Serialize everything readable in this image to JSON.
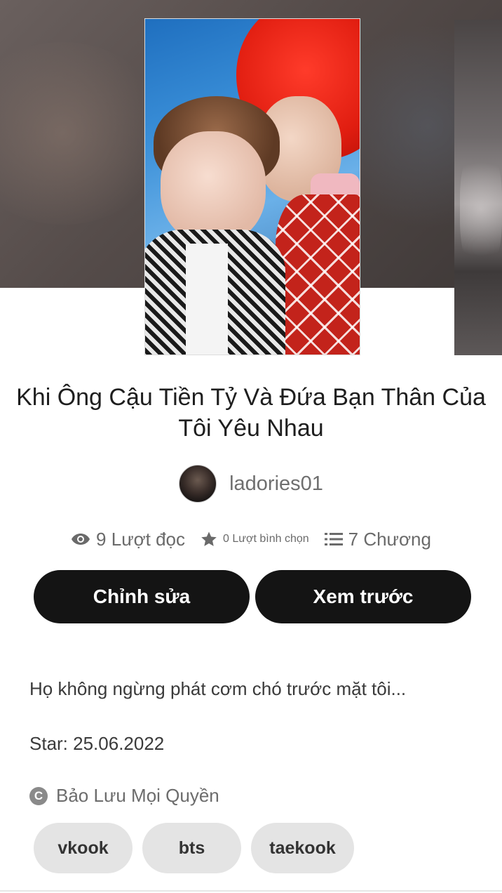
{
  "story": {
    "title": "Khi Ông Cậu Tiền Tỷ Và Đứa Bạn Thân Của Tôi Yêu Nhau",
    "author": "ladories01",
    "stats": {
      "reads": "9 Lượt đọc",
      "votes": "0 Lượt bình chọn",
      "chapters": "7 Chương"
    },
    "description": "Họ không ngừng phát cơm chó trước mặt tôi...",
    "start_date": "Star: 25.06.2022",
    "copyright": "Bảo Lưu Mọi Quyền",
    "tags": [
      "vkook",
      "bts",
      "taekook"
    ]
  },
  "actions": {
    "edit_label": "Chỉnh sửa",
    "preview_label": "Xem trước"
  },
  "icons": {
    "reads": "eye-icon",
    "votes": "star-icon",
    "chapters": "list-icon",
    "copyright": "copyright-icon"
  },
  "colors": {
    "button_bg": "#141414",
    "tag_bg": "#e4e4e4",
    "muted_text": "#6a6a6a"
  }
}
